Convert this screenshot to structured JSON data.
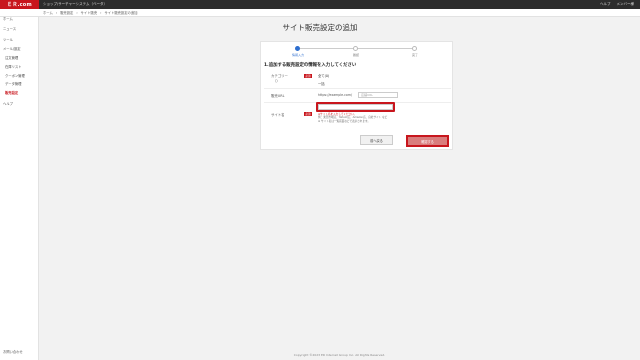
{
  "header": {
    "logo": "ＥＲ.com",
    "title": "ショップ/サーチャーシステム（ベータ）",
    "right_links": [
      "ヘルプ",
      "メンバー様"
    ]
  },
  "breadcrumb": [
    "ホーム",
    "販売設定",
    "サイト販売",
    "サイト販売設定の追加"
  ],
  "sidebar": {
    "items": [
      {
        "label": "ホーム"
      },
      {
        "label": "ニュース"
      },
      {
        "label": "ツール"
      },
      {
        "label": "メール/設定"
      },
      {
        "label": "注文管理"
      },
      {
        "label": "在庫リスト"
      },
      {
        "label": "クーポン管理"
      },
      {
        "label": "データ管理"
      },
      {
        "label": "販売設定"
      },
      {
        "label": "ヘルプ"
      }
    ],
    "bottom": "お問い合わせ"
  },
  "page": {
    "title": "サイト販売設定の追加",
    "steps": [
      "情報入力",
      "確認",
      "完了"
    ],
    "section_heading": "1.追加する販売設定の情報を入力してください",
    "fields": {
      "category_label": "カテゴリー",
      "category_label_2": "（）",
      "category_value_1": "全て(0)",
      "category_value_2": "一括",
      "url_label": "販売URL",
      "url_prefix": "https://example.com/",
      "url_placeholder": "店舗URL",
      "name_label": "サイト名",
      "name_placeholder": "",
      "hint_1": "※サイト名を入力してください。",
      "hint_2": "例：楽天市場店、Yahoo!店、Amazon店、自社サイト など",
      "hint_3": "※ サイト名は一覧画面などで表示されます。"
    },
    "required_badge": "必須",
    "back_button": "前へ戻る",
    "next_button": "確認する"
  },
  "footer": "Copyright ©2023 ER Internet Group Inc. All Rights Reserved.",
  "colors": {
    "brand_red": "#c8161d",
    "step_active": "#2f6fcf"
  }
}
